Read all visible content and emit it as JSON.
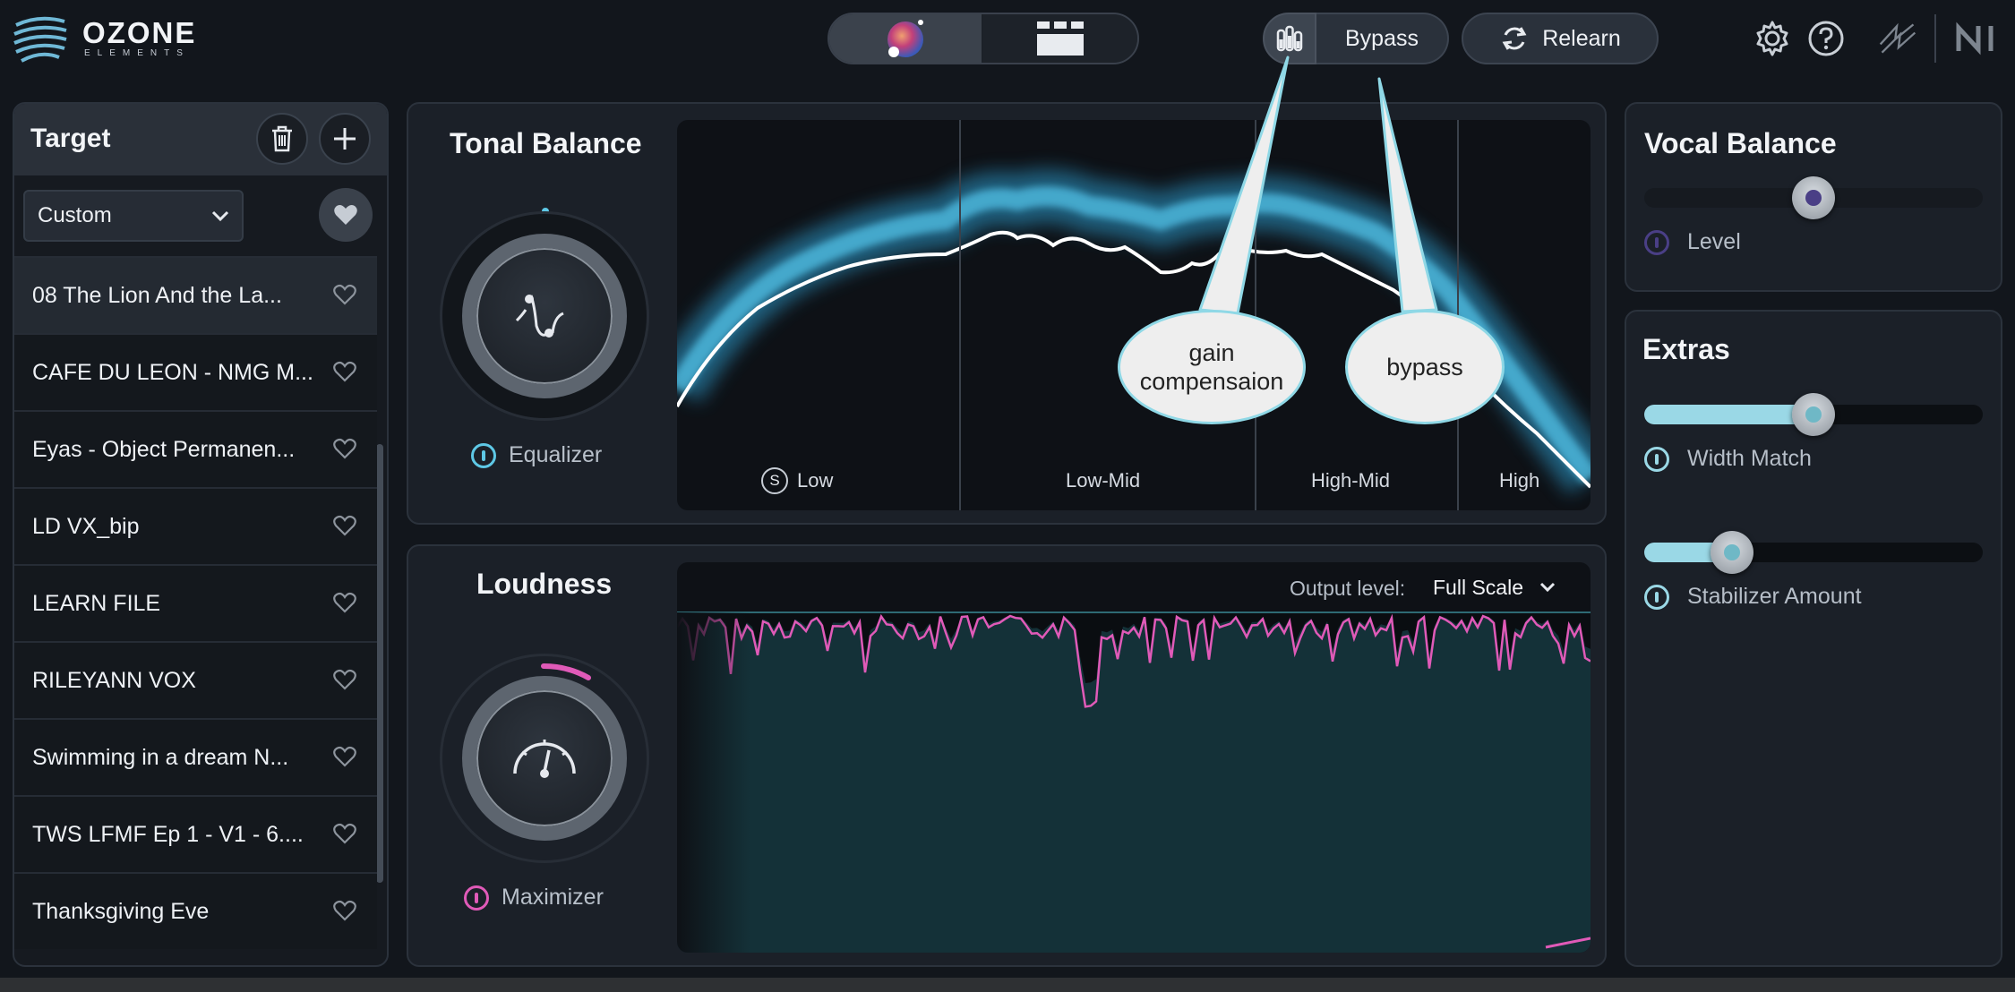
{
  "app": {
    "logo_word": "OZONE",
    "logo_sub": "ELEMENTS"
  },
  "toolbar": {
    "bypass_label": "Bypass",
    "relearn_label": "Relearn"
  },
  "target": {
    "title": "Target",
    "preset_value": "Custom",
    "tracks": [
      {
        "label": "08 The Lion And the La...",
        "selected": true
      },
      {
        "label": "CAFE DU LEON - NMG M...",
        "selected": false
      },
      {
        "label": "Eyas - Object Permanen...",
        "selected": false
      },
      {
        "label": "LD VX_bip",
        "selected": false
      },
      {
        "label": "LEARN FILE",
        "selected": false
      },
      {
        "label": "RILEYANN VOX",
        "selected": false
      },
      {
        "label": "Swimming in a dream N...",
        "selected": false
      },
      {
        "label": "TWS LFMF Ep 1 - V1 - 6....",
        "selected": false
      },
      {
        "label": "Thanksgiving Eve",
        "selected": false
      }
    ]
  },
  "tonal": {
    "title": "Tonal Balance",
    "module_label": "Equalizer",
    "bands": [
      "Low",
      "Low-Mid",
      "High-Mid",
      "High"
    ],
    "solo_glyph": "S"
  },
  "loudness": {
    "title": "Loudness",
    "module_label": "Maximizer",
    "output_label": "Output level:",
    "output_value": "Full Scale"
  },
  "vocal": {
    "title": "Vocal Balance",
    "level_label": "Level",
    "level_value": 0.5
  },
  "extras": {
    "title": "Extras",
    "width_label": "Width Match",
    "width_value": 0.5,
    "stabilizer_label": "Stabilizer Amount",
    "stabilizer_value": 0.26
  },
  "callouts": {
    "gain": "gain compensaion",
    "bypass": "bypass"
  },
  "colors": {
    "accent_blue": "#5ec8e6",
    "accent_pink": "#e05ab8",
    "vocal_purple": "#4a3f86"
  }
}
